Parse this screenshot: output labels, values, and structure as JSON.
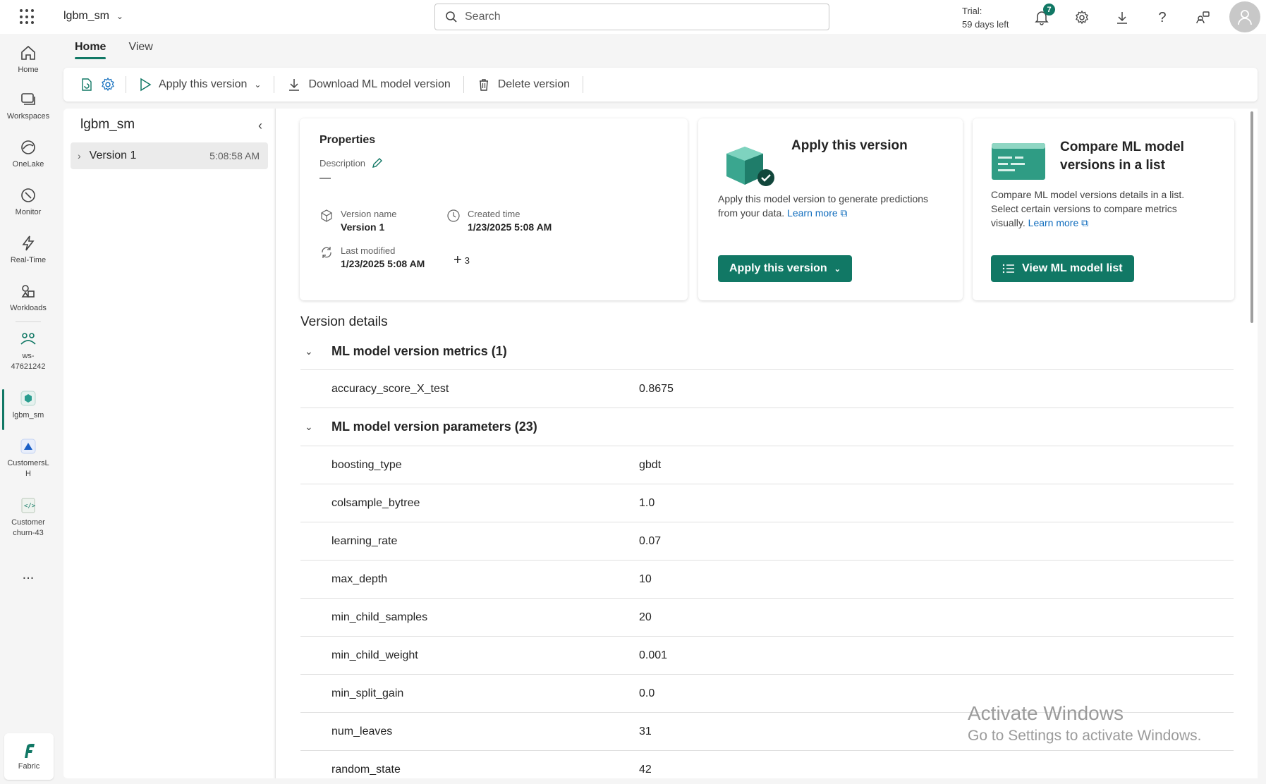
{
  "app": {
    "title": "lgbm_sm"
  },
  "search": {
    "placeholder": "Search"
  },
  "trial": {
    "line1": "Trial:",
    "line2": "59 days left"
  },
  "notifications": {
    "count": "7"
  },
  "leftnav": {
    "items": [
      {
        "label": "Home"
      },
      {
        "label": "Workspaces"
      },
      {
        "label": "OneLake"
      },
      {
        "label": "Monitor"
      },
      {
        "label": "Real-Time"
      },
      {
        "label": "Workloads"
      },
      {
        "label": "ws-\n47621242"
      },
      {
        "label": "lgbm_sm"
      },
      {
        "label": "CustomersL\nH"
      },
      {
        "label": "Customer\nchurn-43"
      }
    ],
    "more": "...",
    "fabric": "Fabric"
  },
  "tabs": [
    {
      "label": "Home"
    },
    {
      "label": "View"
    }
  ],
  "ribbon": {
    "apply": "Apply this version",
    "download": "Download ML model version",
    "delete": "Delete version"
  },
  "leftpanel": {
    "title": "lgbm_sm",
    "version": {
      "label": "Version 1",
      "time": "5:08:58 AM"
    }
  },
  "properties": {
    "title": "Properties",
    "description_label": "Description",
    "description_value": "—",
    "version_name_label": "Version name",
    "version_name_value": "Version 1",
    "created_label": "Created time",
    "created_value": "1/23/2025 5:08 AM",
    "modified_label": "Last modified",
    "modified_value": "1/23/2025 5:08 AM",
    "more_count": "3"
  },
  "apply_card": {
    "title": "Apply this version",
    "desc_line1": "Apply this model version to generate predictions",
    "desc_line2": "from your data.",
    "learn_more": "Learn more",
    "button": "Apply this version"
  },
  "compare_card": {
    "title_line1": "Compare ML model",
    "title_line2": "versions in a list",
    "desc_line1": "Compare ML model versions details in a list.",
    "desc_line2": "Select certain versions to compare metrics",
    "desc_line3": "visually.",
    "learn_more": "Learn more",
    "button": "View ML model list"
  },
  "version_details": {
    "title": "Version details",
    "metrics_header": "ML model version metrics (1)",
    "metrics": [
      {
        "key": "accuracy_score_X_test",
        "value": "0.8675"
      }
    ],
    "params_header": "ML model version parameters (23)",
    "params": [
      {
        "key": "boosting_type",
        "value": "gbdt"
      },
      {
        "key": "colsample_bytree",
        "value": "1.0"
      },
      {
        "key": "learning_rate",
        "value": "0.07"
      },
      {
        "key": "max_depth",
        "value": "10"
      },
      {
        "key": "min_child_samples",
        "value": "20"
      },
      {
        "key": "min_child_weight",
        "value": "0.001"
      },
      {
        "key": "min_split_gain",
        "value": "0.0"
      },
      {
        "key": "num_leaves",
        "value": "31"
      },
      {
        "key": "random_state",
        "value": "42"
      }
    ]
  },
  "watermark": {
    "line1": "Activate Windows",
    "line2": "Go to Settings to activate Windows."
  },
  "colors": {
    "accent": "#117865",
    "link": "#0f6cbd"
  }
}
